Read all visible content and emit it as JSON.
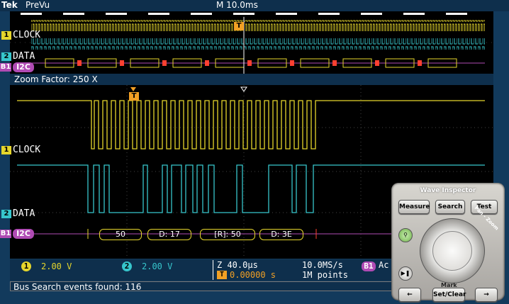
{
  "header": {
    "brand": "Tek",
    "mode": "PreVu",
    "timebase": "M 10.0ms"
  },
  "overview": {
    "ch1_label": "CLOCK",
    "ch2_label": "DATA",
    "bus_label": "I2C",
    "ch1_num": "1",
    "ch2_num": "2",
    "bus_num": "B1",
    "trigger_marker": "T"
  },
  "zoom": {
    "factor_text": "Zoom Factor: 250 X"
  },
  "main": {
    "ch1_label": "CLOCK",
    "ch2_label": "DATA",
    "bus_label": "I2C",
    "ch1_num": "1",
    "ch2_num": "2",
    "bus_num": "B1",
    "trigger_marker": "T",
    "bus_packets": [
      "50",
      "D: 17",
      "[R]: 50",
      "D: 3E"
    ]
  },
  "status": {
    "ch1_num": "1",
    "ch1_scale": "2.00 V",
    "ch2_num": "2",
    "ch2_scale": "2.00 V",
    "zoom_time": "Z 40.0µs",
    "trigger_pos": "0.00000 s",
    "sample_rate": "10.0MS/s",
    "record_length": "1M points",
    "bus_num": "B1",
    "bus_state": "Ac"
  },
  "footer": {
    "search_text": "Bus Search events found: 116"
  },
  "panel": {
    "title": "Wave Inspector",
    "measure": "Measure",
    "search": "Search",
    "test": "Test",
    "pan_zoom": "Pan - Zoom",
    "mark": "Mark",
    "set_clear": "Set/Clear",
    "prev_arrow": "←",
    "next_arrow": "→"
  },
  "colors": {
    "ch1": "#e6d62c",
    "ch2": "#37c6cc",
    "bus": "#b04bb4",
    "bus_error": "#ff4030"
  }
}
